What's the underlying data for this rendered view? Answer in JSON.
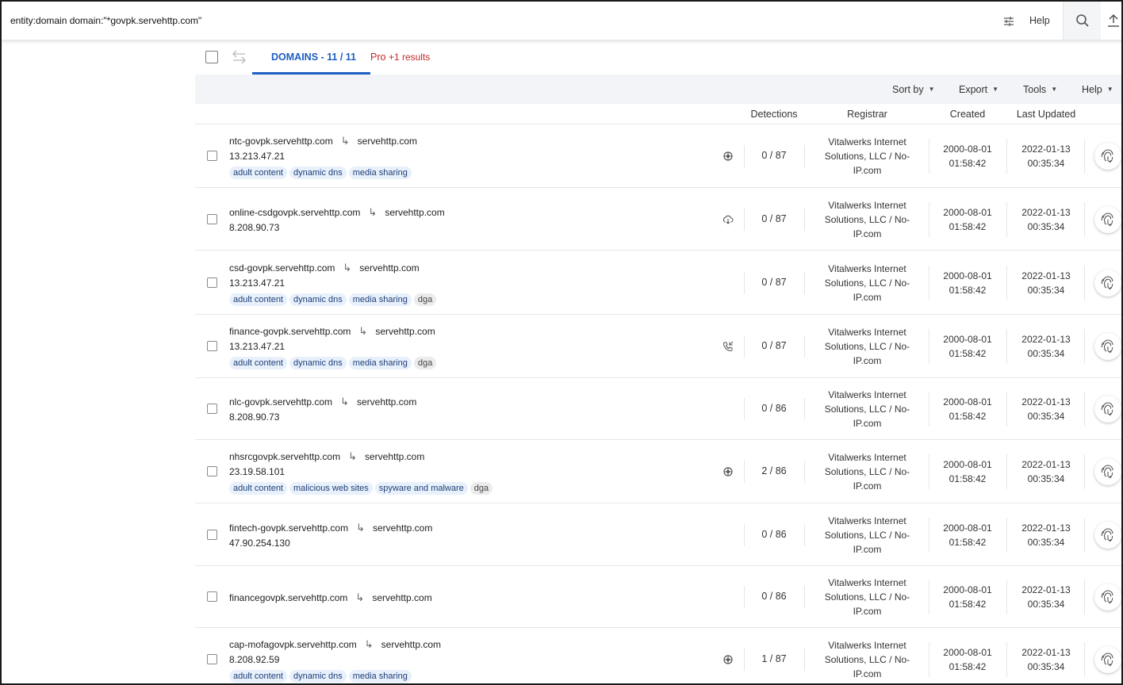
{
  "search": {
    "query": "entity:domain domain:\"*govpk.servehttp.com\"",
    "filter_icon": "sliders-icon",
    "help_label": "Help",
    "search_icon": "search-icon",
    "upload_icon": "upload-icon"
  },
  "tabs": {
    "domains_label": "DOMAINS - 11 / 11",
    "pro_label": "Pro",
    "pro_extra": "+1 results"
  },
  "toolbar": {
    "sort_label": "Sort by",
    "export_label": "Export",
    "tools_label": "Tools",
    "help_label": "Help"
  },
  "columns": {
    "detections": "Detections",
    "registrar": "Registrar",
    "created": "Created",
    "updated": "Last Updated"
  },
  "rows": [
    {
      "domain": "ntc-govpk.servehttp.com",
      "parent": "servehttp.com",
      "ip": "13.213.47.21",
      "tags": [
        "adult content",
        "dynamic dns",
        "media sharing"
      ],
      "icon": "bug-icon",
      "detections": "0 / 87",
      "registrar_1": "Vitalwerks Internet",
      "registrar_2": "Solutions, LLC / No-",
      "registrar_3": "IP.com",
      "created_date": "2000-08-01",
      "created_time": "01:58:42",
      "updated_date": "2022-01-13",
      "updated_time": "00:35:34"
    },
    {
      "domain": "online-csdgovpk.servehttp.com",
      "parent": "servehttp.com",
      "ip": "8.208.90.73",
      "tags": [],
      "icon": "cloud-download-icon",
      "detections": "0 / 87",
      "registrar_1": "Vitalwerks Internet",
      "registrar_2": "Solutions, LLC / No-",
      "registrar_3": "IP.com",
      "created_date": "2000-08-01",
      "created_time": "01:58:42",
      "updated_date": "2022-01-13",
      "updated_time": "00:35:34"
    },
    {
      "domain": "csd-govpk.servehttp.com",
      "parent": "servehttp.com",
      "ip": "13.213.47.21",
      "tags": [
        "adult content",
        "dynamic dns",
        "media sharing",
        "dga"
      ],
      "icon": "",
      "detections": "0 / 87",
      "registrar_1": "Vitalwerks Internet",
      "registrar_2": "Solutions, LLC / No-",
      "registrar_3": "IP.com",
      "created_date": "2000-08-01",
      "created_time": "01:58:42",
      "updated_date": "2022-01-13",
      "updated_time": "00:35:34"
    },
    {
      "domain": "finance-govpk.servehttp.com",
      "parent": "servehttp.com",
      "ip": "13.213.47.21",
      "tags": [
        "adult content",
        "dynamic dns",
        "media sharing",
        "dga"
      ],
      "icon": "phone-callback-icon",
      "detections": "0 / 87",
      "registrar_1": "Vitalwerks Internet",
      "registrar_2": "Solutions, LLC / No-",
      "registrar_3": "IP.com",
      "created_date": "2000-08-01",
      "created_time": "01:58:42",
      "updated_date": "2022-01-13",
      "updated_time": "00:35:34"
    },
    {
      "domain": "nlc-govpk.servehttp.com",
      "parent": "servehttp.com",
      "ip": "8.208.90.73",
      "tags": [],
      "icon": "",
      "detections": "0 / 86",
      "registrar_1": "Vitalwerks Internet",
      "registrar_2": "Solutions, LLC / No-",
      "registrar_3": "IP.com",
      "created_date": "2000-08-01",
      "created_time": "01:58:42",
      "updated_date": "2022-01-13",
      "updated_time": "00:35:34"
    },
    {
      "domain": "nhsrcgovpk.servehttp.com",
      "parent": "servehttp.com",
      "ip": "23.19.58.101",
      "tags": [
        "adult content",
        "malicious web sites",
        "spyware and malware",
        "dga"
      ],
      "icon": "bug-icon",
      "detections": "2 / 86",
      "registrar_1": "Vitalwerks Internet",
      "registrar_2": "Solutions, LLC / No-",
      "registrar_3": "IP.com",
      "created_date": "2000-08-01",
      "created_time": "01:58:42",
      "updated_date": "2022-01-13",
      "updated_time": "00:35:34"
    },
    {
      "domain": "fintech-govpk.servehttp.com",
      "parent": "servehttp.com",
      "ip": "47.90.254.130",
      "tags": [],
      "icon": "",
      "detections": "0 / 86",
      "registrar_1": "Vitalwerks Internet",
      "registrar_2": "Solutions, LLC / No-",
      "registrar_3": "IP.com",
      "created_date": "2000-08-01",
      "created_time": "01:58:42",
      "updated_date": "2022-01-13",
      "updated_time": "00:35:34"
    },
    {
      "domain": "financegovpk.servehttp.com",
      "parent": "servehttp.com",
      "ip": "",
      "tags": [],
      "icon": "",
      "detections": "0 / 86",
      "registrar_1": "Vitalwerks Internet",
      "registrar_2": "Solutions, LLC / No-",
      "registrar_3": "IP.com",
      "created_date": "2000-08-01",
      "created_time": "01:58:42",
      "updated_date": "2022-01-13",
      "updated_time": "00:35:34"
    },
    {
      "domain": "cap-mofagovpk.servehttp.com",
      "parent": "servehttp.com",
      "ip": "8.208.92.59",
      "tags": [
        "adult content",
        "dynamic dns",
        "media sharing"
      ],
      "icon": "bug-icon",
      "detections": "1 / 87",
      "registrar_1": "Vitalwerks Internet",
      "registrar_2": "Solutions, LLC / No-",
      "registrar_3": "IP.com",
      "created_date": "2000-08-01",
      "created_time": "01:58:42",
      "updated_date": "2022-01-13",
      "updated_time": "00:35:34"
    }
  ]
}
